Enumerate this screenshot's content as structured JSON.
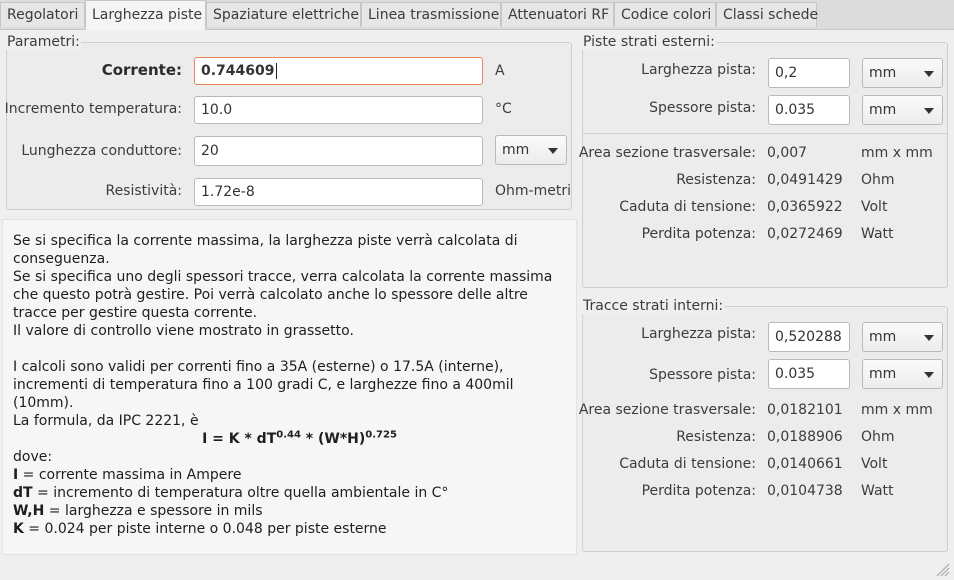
{
  "tabs": [
    {
      "label": "Regolatori"
    },
    {
      "label": "Larghezza piste"
    },
    {
      "label": "Spaziature elettriche"
    },
    {
      "label": "Linea trasmissione"
    },
    {
      "label": "Attenuatori RF"
    },
    {
      "label": "Codice colori"
    },
    {
      "label": "Classi schede"
    }
  ],
  "active_tab": "Larghezza piste",
  "params": {
    "title": "Parametri:",
    "current_label": "Corrente:",
    "current_value": "0.744609",
    "current_unit": "A",
    "temp_label": "Incremento temperatura:",
    "temp_value": "10.0",
    "temp_unit": "°C",
    "length_label": "Lunghezza conduttore:",
    "length_value": "20",
    "length_unit": "mm",
    "resist_label": "Resistività:",
    "resist_value": "1.72e-8",
    "resist_unit": "Ohm-metri"
  },
  "external": {
    "title": "Piste strati esterni:",
    "width_label": "Larghezza pista:",
    "width_value": "0,2",
    "width_unit": "mm",
    "thick_label": "Spessore pista:",
    "thick_value": "0.035",
    "thick_unit": "mm",
    "area_label": "Area sezione trasversale:",
    "area_value": "0,007",
    "area_unit": "mm x mm",
    "res_label": "Resistenza:",
    "res_value": "0,0491429",
    "res_unit": "Ohm",
    "drop_label": "Caduta di tensione:",
    "drop_value": "0,0365922",
    "drop_unit": "Volt",
    "loss_label": "Perdita potenza:",
    "loss_value": "0,0272469",
    "loss_unit": "Watt"
  },
  "internal": {
    "title": "Tracce strati interni:",
    "width_label": "Larghezza pista:",
    "width_value": "0,520288",
    "width_unit": "mm",
    "thick_label": "Spessore pista:",
    "thick_value": "0.035",
    "thick_unit": "mm",
    "area_label": "Area sezione trasversale:",
    "area_value": "0,0182101",
    "area_unit": "mm x mm",
    "res_label": "Resistenza:",
    "res_value": "0,0188906",
    "res_unit": "Ohm",
    "drop_label": "Caduta di tensione:",
    "drop_value": "0,0140661",
    "drop_unit": "Volt",
    "loss_label": "Perdita potenza:",
    "loss_value": "0,0104738",
    "loss_unit": "Watt"
  },
  "info": {
    "p1": "Se si specifica la corrente massima, la larghezza piste verrà calcolata di conseguenza.",
    "p2": "Se si specifica uno degli spessori tracce, verra calcolata la corrente massima che questo potrà gestire. Poi verrà calcolato anche lo spessore delle altre tracce per gestire questa corrente.",
    "p3": "Il valore di controllo viene mostrato in grassetto.",
    "p4": "I calcoli sono validi per correnti fino a 35A (esterne) o 17.5A (interne), incrementi di temperatura fino a 100 gradi C, e larghezze fino a 400mil (10mm).",
    "p5": "La formula, da IPC 2221, è",
    "formula_a": "I = K * dT",
    "formula_exp1": "0.44",
    "formula_b": " * (W*H)",
    "formula_exp2": "0.725",
    "where": "dove:",
    "def1_key": "I",
    "def1_text": " = corrente massima in Ampere",
    "def2_key": "dT",
    "def2_text": " = incremento di temperatura oltre quella ambientale in C°",
    "def3_key": "W,H",
    "def3_text": " = larghezza e spessore in mils",
    "def4_key": "K",
    "def4_text": " = 0.024 per piste interne o 0.048 per piste esterne"
  }
}
